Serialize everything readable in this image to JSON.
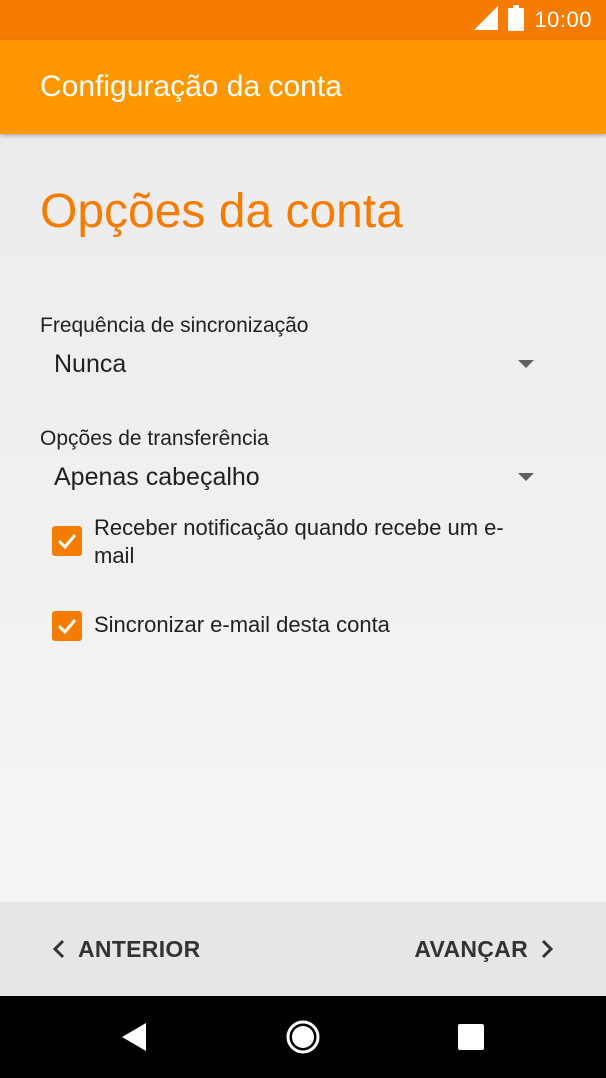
{
  "status_bar": {
    "time": "10:00",
    "icons": [
      "signal-icon",
      "battery-icon"
    ]
  },
  "app_bar": {
    "title": "Configuração da conta"
  },
  "page": {
    "title": "Opções da conta"
  },
  "sync_frequency": {
    "label": "Frequência de sincronização",
    "value": "Nunca"
  },
  "transfer_options": {
    "label": "Opções de transferência",
    "value": "Apenas cabeçalho"
  },
  "checkboxes": [
    {
      "label": "Receber notificação quando recebe um e-mail",
      "checked": true
    },
    {
      "label": "Sincronizar e-mail desta conta",
      "checked": true
    }
  ],
  "footer": {
    "prev_label": "ANTERIOR",
    "next_label": "AVANÇAR"
  },
  "system_nav": {
    "icons": [
      "back-icon",
      "home-icon",
      "recents-icon"
    ]
  },
  "colors": {
    "status_bar": "#f57c00",
    "app_bar": "#ff9800",
    "accent": "#f57c00"
  }
}
